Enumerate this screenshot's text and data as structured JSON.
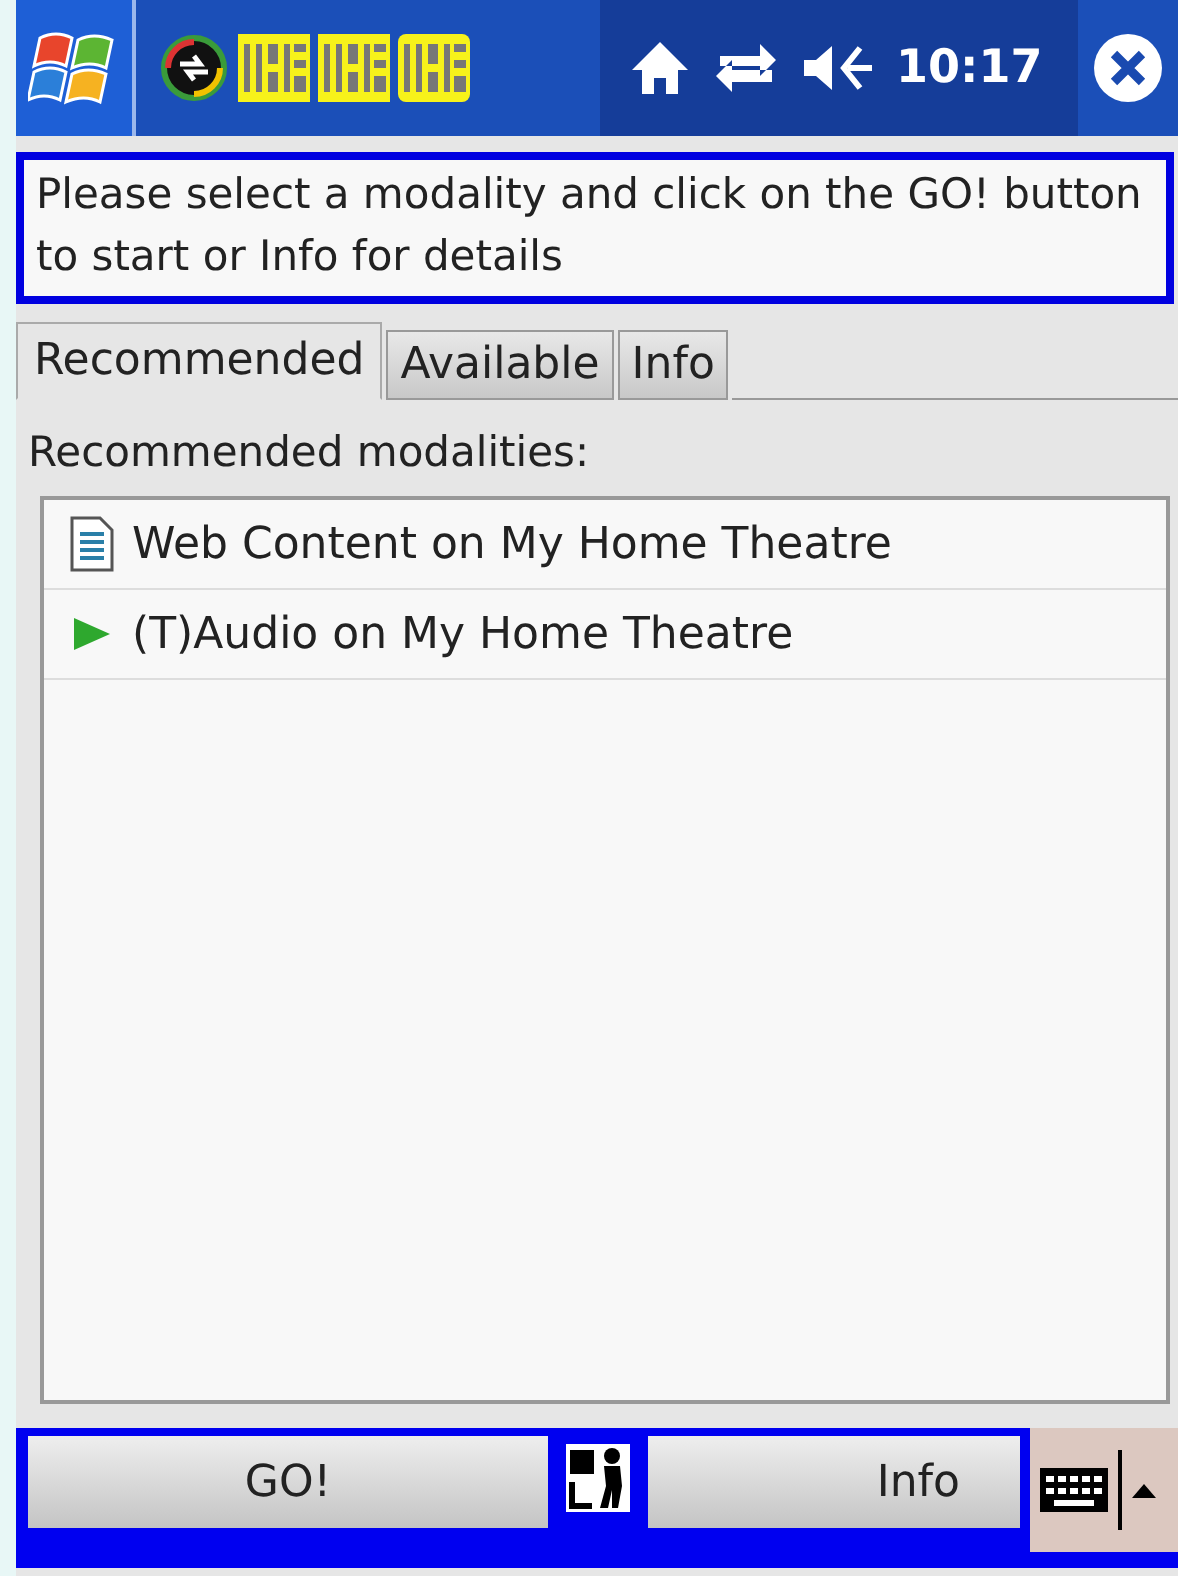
{
  "status_bar": {
    "time": "10:17"
  },
  "message": {
    "value": "Please select a modality and click on the GO! button to start or Info for details"
  },
  "tabs": [
    {
      "label": "Recommended",
      "selected": true
    },
    {
      "label": "Available",
      "selected": false
    },
    {
      "label": "Info",
      "selected": false
    }
  ],
  "list_label": "Recommended modalities:",
  "modalities": [
    {
      "label": "Web Content on My Home Theatre",
      "kind": "document"
    },
    {
      "label": "(T)Audio on My Home Theatre",
      "kind": "play"
    }
  ],
  "buttons": [
    {
      "label": "GO!"
    },
    {
      "label": "Info"
    }
  ]
}
